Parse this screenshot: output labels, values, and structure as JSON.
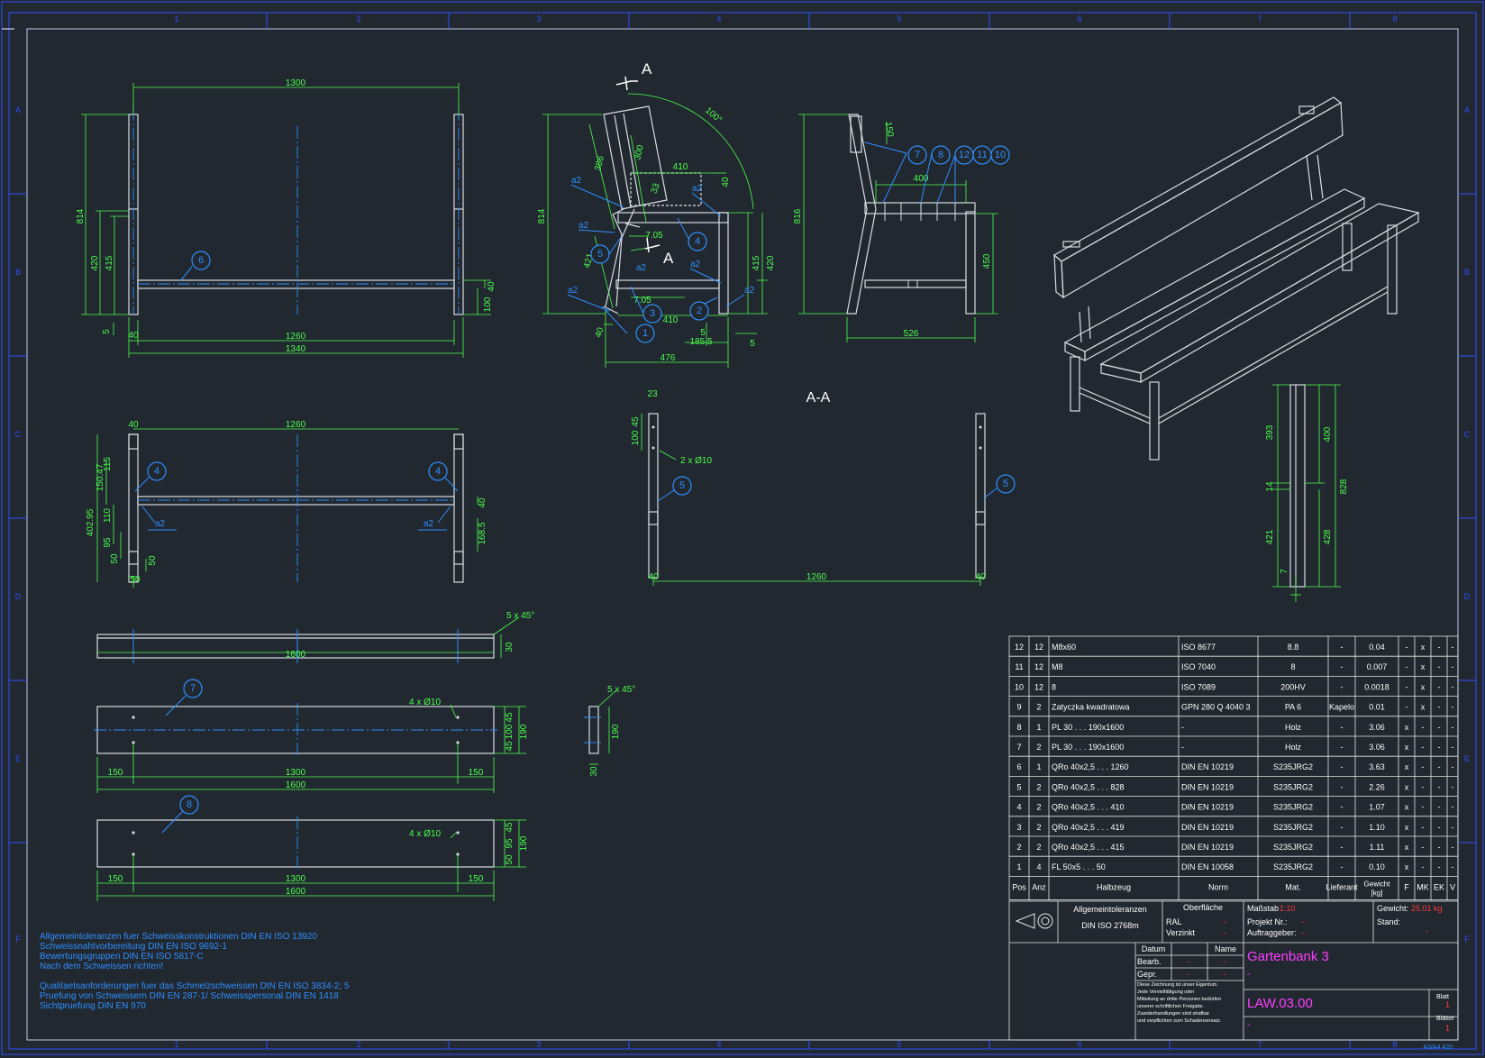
{
  "title_block": {
    "tolerances_label": "Allgemeintoleranzen",
    "tolerances_norm": "DIN ISO 2768m",
    "surface_label": "Oberfläche",
    "ral_label": "RAL",
    "zinc_label": "Verzinkt",
    "dash": "-",
    "scale_label": "Maßstab",
    "scale_value": "1:10",
    "weight_label": "Gewicht:",
    "weight_value": "25.01 kg",
    "project_label": "Projekt Nr.:",
    "client_label": "Auftraggeber:",
    "status_label": "Stand:",
    "date_label": "Datum",
    "name_label": "Name",
    "drawn_label": "Bearb.",
    "checked_label": "Gepr.",
    "title": "Gartenbank 3",
    "drawing_number": "LAW.03.00",
    "sheet_label": "Blatt",
    "sheet_value": "1",
    "sheets_label": "Blätter",
    "sheets_value": "1",
    "copyright": [
      "Diese Zeichnung ist unser Eigentum.",
      "Jede Vervielfältigung oder",
      "Mitteilung an dritte Personen bedürfen",
      "unserer schriftlichen Freigabe.",
      "Zuwiderhandlungen sind strafbar",
      "und verpflichten zum Schadensersatz."
    ],
    "corner_code": "A3/A4 420"
  },
  "notes": [
    "Allgemeintoleranzen fuer Schweisskonstruktionen DIN EN ISO 13920",
    "Schweissnahtvorbereitung DIN EN ISO 9692-1",
    "Bewertungsgruppen DIN EN ISO 5817-C",
    "Nach dem Schweissen richten!",
    "Qualitaetsanforderungen fuer das Schmelzschweissen DIN EN ISO 3834-2; 5",
    "Pruefung von Schweissern DIN EN 287-1/ Schweisspersonal DIN EN 1418",
    "Sichtpruefung DIN EN 970"
  ],
  "bom": {
    "headers": [
      "Pos",
      "Anz",
      "Halbzeug",
      "Norm",
      "Mat.",
      "Lieferant",
      "Gewicht [kg]",
      "F",
      "MK",
      "EK",
      "V"
    ],
    "rows": [
      [
        "12",
        "12",
        "M8x60",
        "ISO 8677",
        "8.8",
        "-",
        "0.04",
        "-",
        "x",
        "-",
        "-"
      ],
      [
        "11",
        "12",
        "M8",
        "ISO 7040",
        "8",
        "-",
        "0.007",
        "-",
        "x",
        "-",
        "-"
      ],
      [
        "10",
        "12",
        "8",
        "ISO 7089",
        "200HV",
        "-",
        "0.0018",
        "-",
        "x",
        "-",
        "-"
      ],
      [
        "9",
        "2",
        "Zatyczka kwadratowa",
        "GPN 280 Q 4040 3",
        "PA 6",
        "Kapelo",
        "0.01",
        "-",
        "x",
        "-",
        "-"
      ],
      [
        "8",
        "1",
        "PL 30 . . . 190x1600",
        "-",
        "Holz",
        "-",
        "3.06",
        "x",
        "-",
        "-",
        "-"
      ],
      [
        "7",
        "2",
        "PL 30 . . . 190x1600",
        "-",
        "Holz",
        "-",
        "3.06",
        "x",
        "-",
        "-",
        "-"
      ],
      [
        "6",
        "1",
        "QRo 40x2,5 . . . 1260",
        "DIN EN 10219",
        "S235JRG2",
        "-",
        "3.63",
        "x",
        "-",
        "-",
        "-"
      ],
      [
        "5",
        "2",
        "QRo 40x2,5 . . . 828",
        "DIN EN 10219",
        "S235JRG2",
        "-",
        "2.26",
        "x",
        "-",
        "-",
        "-"
      ],
      [
        "4",
        "2",
        "QRo 40x2,5 . . . 410",
        "DIN EN 10219",
        "S235JRG2",
        "-",
        "1.07",
        "x",
        "-",
        "-",
        "-"
      ],
      [
        "3",
        "2",
        "QRo 40x2,5 . . . 419",
        "DIN EN 10219",
        "S235JRG2",
        "-",
        "1.10",
        "x",
        "-",
        "-",
        "-"
      ],
      [
        "2",
        "2",
        "QRo 40x2,5 . . . 415",
        "DIN EN 10219",
        "S235JRG2",
        "-",
        "1.11",
        "x",
        "-",
        "-",
        "-"
      ],
      [
        "1",
        "4",
        "FL 50x5 . . . 50",
        "DIN EN 10058",
        "S235JRG2",
        "-",
        "0.10",
        "x",
        "-",
        "-",
        "-"
      ]
    ]
  },
  "frame": {
    "top_numbers": [
      "1",
      "2",
      "3",
      "4",
      "5",
      "6",
      "7",
      "8"
    ],
    "side_letters": [
      "A",
      "B",
      "C",
      "D",
      "E",
      "F"
    ]
  },
  "views": {
    "section_label": "A-A",
    "section_mark": "A"
  },
  "dims": {
    "front": {
      "w1300": "1300",
      "h814": "814",
      "h420": "420",
      "h415": "415",
      "h40": "40",
      "h100": "100",
      "h5": "5",
      "w40": "40",
      "w1260": "1260",
      "w1340": "1340"
    },
    "side": {
      "h814": "814",
      "d386": "386",
      "d300": "300",
      "d410top": "410",
      "d40": "40",
      "d33": "33",
      "d705": "7.05",
      "d705b": "7.05",
      "d421": "421",
      "d410": "410",
      "d185": "185.5",
      "d5a": "5",
      "d5b": "5",
      "d476": "476",
      "d415": "415",
      "d420": "420",
      "d40b": "40",
      "angle": "100°"
    },
    "side2": {
      "h816": "816",
      "d400": "400",
      "d150": "150",
      "h450": "450",
      "w526": "526"
    },
    "top": {
      "w1260": "1260",
      "w40": "40",
      "d402": "402.95",
      "d15047": "150.47",
      "d115": "115",
      "d110": "110",
      "d95": "95",
      "d50": "50",
      "d50b": "50",
      "d50c": "50",
      "d40b": "40",
      "d1685": "168.5"
    },
    "section": {
      "d23": "23",
      "d45": "45",
      "d100": "100",
      "holes": "2 x Ø10",
      "w1260": "1260",
      "d40": "40",
      "d40b": "40"
    },
    "leg": {
      "d393": "393",
      "d14": "14",
      "d421": "421",
      "d400": "400",
      "d828": "828",
      "d428": "428",
      "d7": "7"
    },
    "boards": {
      "chamfer1": "5 x 45°",
      "w1600a": "1600",
      "t30": "30",
      "holes7": "4 x Ø10",
      "d45a": "45",
      "d100a": "100",
      "d45b": "45",
      "h190a": "190",
      "d150a": "150",
      "d1300a": "1300",
      "d150b": "150",
      "w1600b": "1600",
      "chamfer2": "5 x 45°",
      "h190b": "190",
      "t30b": "30",
      "holes8": "4 x Ø10",
      "d45c": "45",
      "d95": "95",
      "d50": "50",
      "h190c": "190",
      "d150c": "150",
      "d1300b": "1300",
      "d150d": "150",
      "w1600c": "1600"
    }
  },
  "weld_label": "a2",
  "balloons": [
    "1",
    "2",
    "3",
    "4",
    "5",
    "6",
    "7",
    "8",
    "9",
    "10",
    "11",
    "12"
  ]
}
